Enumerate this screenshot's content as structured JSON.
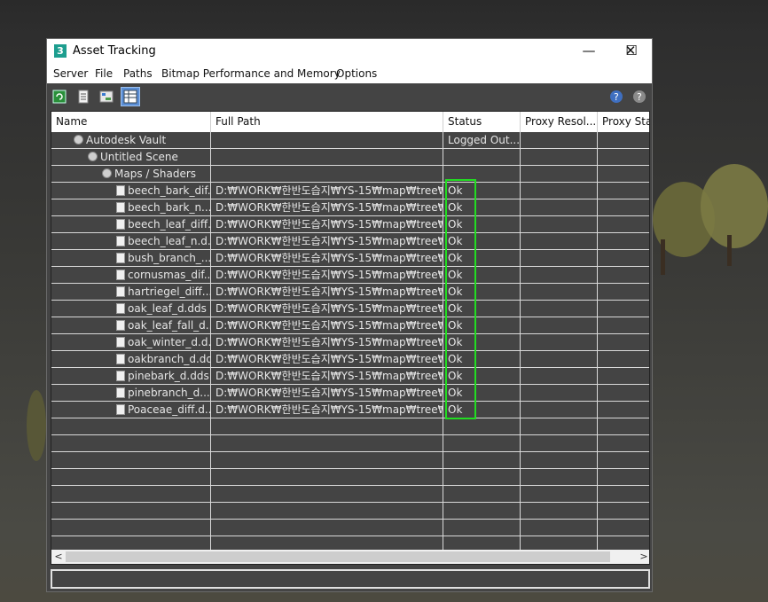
{
  "window": {
    "title": "Asset Tracking",
    "app_icon": "3",
    "controls": {
      "minimize": "—",
      "maximize": "☐",
      "close": "✕"
    }
  },
  "menu": [
    "Server",
    "File",
    "Paths",
    "Bitmap Performance and Memory",
    "Options"
  ],
  "toolbar": {
    "left_icons": [
      "refresh-icon",
      "list-icon",
      "tree-view-icon",
      "table-view-icon"
    ],
    "right_icons": [
      "help-icon",
      "help-alt-icon"
    ]
  },
  "columns": [
    "Name",
    "Full Path",
    "Status",
    "Proxy Resol...",
    "Proxy Stat"
  ],
  "rows": [
    {
      "name": "Autodesk Vault",
      "path": "",
      "status": "Logged Out...",
      "level": 0,
      "icon": "vault-icon"
    },
    {
      "name": "Untitled Scene",
      "path": "",
      "status": "",
      "level": 1,
      "icon": "scene-icon"
    },
    {
      "name": "Maps / Shaders",
      "path": "",
      "status": "",
      "level": 2,
      "icon": "maps-icon"
    },
    {
      "name": "beech_bark_dif...",
      "path": "D:₩WORK₩한반도습지₩YS-15₩map₩tree₩",
      "status": "Ok",
      "level": 3,
      "icon": "bitmap-file-icon"
    },
    {
      "name": "beech_bark_n....",
      "path": "D:₩WORK₩한반도습지₩YS-15₩map₩tree₩",
      "status": "Ok",
      "level": 3,
      "icon": "bitmap-file-icon"
    },
    {
      "name": "beech_leaf_diff...",
      "path": "D:₩WORK₩한반도습지₩YS-15₩map₩tree₩",
      "status": "Ok",
      "level": 3,
      "icon": "bitmap-file-icon"
    },
    {
      "name": "beech_leaf_n.d...",
      "path": "D:₩WORK₩한반도습지₩YS-15₩map₩tree₩",
      "status": "Ok",
      "level": 3,
      "icon": "bitmap-file-icon"
    },
    {
      "name": "bush_branch_...",
      "path": "D:₩WORK₩한반도습지₩YS-15₩map₩tree₩",
      "status": "Ok",
      "level": 3,
      "icon": "bitmap-file-icon"
    },
    {
      "name": "cornusmas_dif...",
      "path": "D:₩WORK₩한반도습지₩YS-15₩map₩tree₩",
      "status": "Ok",
      "level": 3,
      "icon": "bitmap-file-icon"
    },
    {
      "name": "hartriegel_diff....",
      "path": "D:₩WORK₩한반도습지₩YS-15₩map₩tree₩",
      "status": "Ok",
      "level": 3,
      "icon": "bitmap-file-icon"
    },
    {
      "name": "oak_leaf_d.dds",
      "path": "D:₩WORK₩한반도습지₩YS-15₩map₩tree₩",
      "status": "Ok",
      "level": 3,
      "icon": "bitmap-file-icon"
    },
    {
      "name": "oak_leaf_fall_d....",
      "path": "D:₩WORK₩한반도습지₩YS-15₩map₩tree₩",
      "status": "Ok",
      "level": 3,
      "icon": "bitmap-file-icon"
    },
    {
      "name": "oak_winter_d.d...",
      "path": "D:₩WORK₩한반도습지₩YS-15₩map₩tree₩",
      "status": "Ok",
      "level": 3,
      "icon": "bitmap-file-icon"
    },
    {
      "name": "oakbranch_d.dd...",
      "path": "D:₩WORK₩한반도습지₩YS-15₩map₩tree₩",
      "status": "Ok",
      "level": 3,
      "icon": "bitmap-file-icon"
    },
    {
      "name": "pinebark_d.dds",
      "path": "D:₩WORK₩한반도습지₩YS-15₩map₩tree₩",
      "status": "Ok",
      "level": 3,
      "icon": "bitmap-file-icon"
    },
    {
      "name": "pinebranch_d....",
      "path": "D:₩WORK₩한반도습지₩YS-15₩map₩tree₩",
      "status": "Ok",
      "level": 3,
      "icon": "bitmap-file-icon"
    },
    {
      "name": "Poaceae_diff.d...",
      "path": "D:₩WORK₩한반도습지₩YS-15₩map₩tree₩",
      "status": "Ok",
      "level": 3,
      "icon": "bitmap-file-icon"
    }
  ],
  "empty_rows": 8,
  "scrollbar": {
    "left_arrow": "<",
    "right_arrow": ">"
  },
  "colors": {
    "highlight": "#22dd22",
    "panel": "#444444"
  }
}
